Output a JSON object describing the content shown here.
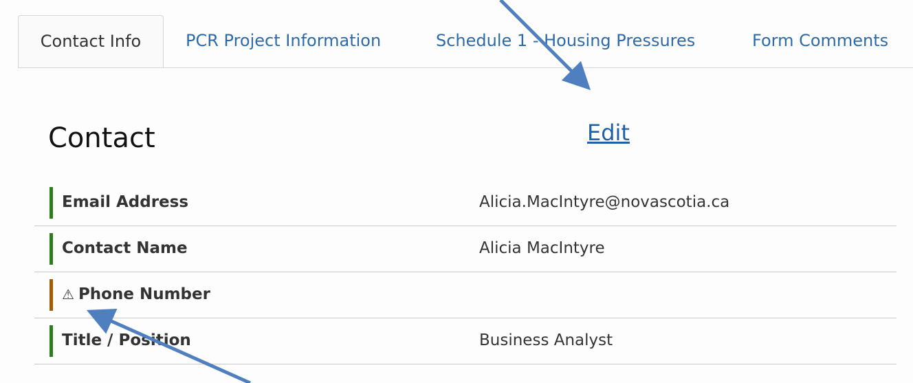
{
  "tabs": [
    {
      "label": "Contact Info",
      "active": true
    },
    {
      "label": "PCR Project Information",
      "active": false
    },
    {
      "label": "Schedule 1 - Housing Pressures",
      "active": false
    },
    {
      "label": "Form Comments",
      "active": false
    }
  ],
  "section": {
    "title": "Contact",
    "edit_label": "Edit"
  },
  "fields": [
    {
      "label": "Email Address",
      "value": "Alicia.MacIntyre@novascotia.ca",
      "status": "ok"
    },
    {
      "label": "Contact Name",
      "value": "Alicia MacIntyre",
      "status": "ok"
    },
    {
      "label": "Phone Number",
      "value": "",
      "status": "warning",
      "icon": "warning-icon"
    },
    {
      "label": "Title / Position",
      "value": "Business Analyst",
      "status": "ok"
    }
  ],
  "colors": {
    "ok_bar": "#2e7d1c",
    "warning_bar": "#a15c00",
    "link": "#2d6aa8",
    "arrow": "#4f7fbf"
  },
  "icons": {
    "warning": "⚠"
  }
}
